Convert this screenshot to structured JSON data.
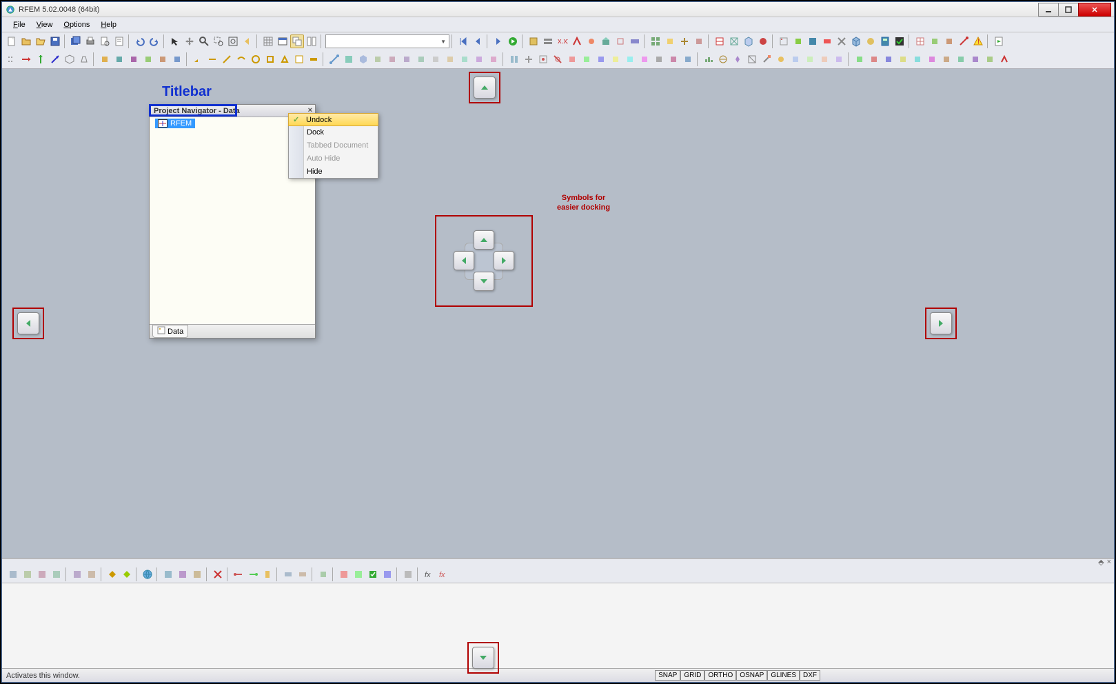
{
  "window": {
    "title": "RFEM 5.02.0048 (64bit)"
  },
  "menu": {
    "file": "File",
    "view": "View",
    "options": "Options",
    "help": "Help"
  },
  "panel": {
    "title": "Project Navigator - Data",
    "tree_root": "RFEM",
    "tab": "Data"
  },
  "context_menu": {
    "undock": "Undock",
    "dock": "Dock",
    "tabbed": "Tabbed Document",
    "autohide": "Auto Hide",
    "hide": "Hide"
  },
  "annotations": {
    "titlebar": "Titlebar",
    "docking1": "Symbols for",
    "docking2": "easier docking"
  },
  "status": {
    "text": "Activates this window.",
    "snap": "SNAP",
    "grid": "GRID",
    "ortho": "ORTHO",
    "osnap": "OSNAP",
    "glines": "GLINES",
    "dxf": "DXF"
  },
  "bottom_head": {
    "pin": "⬘",
    "close": "×"
  }
}
